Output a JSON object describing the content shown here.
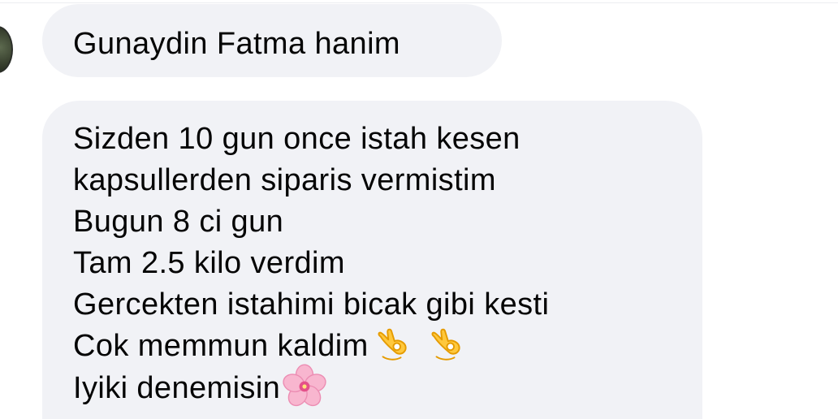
{
  "chat": {
    "messages": [
      {
        "lines": [
          "Gunaydin Fatma hanim"
        ]
      },
      {
        "lines": [
          "Sizden 10 gun once istah kesen",
          "kapsullerden siparis vermistim",
          "Bugun 8 ci gun",
          "Tam 2.5 kilo verdim",
          "Gercekten istahimi bicak gibi kesti",
          "Cok memmun kaldim",
          "Iyiki denemisin"
        ],
        "emojis": {
          "line_6": [
            "ok-hand-emoji",
            "ok-hand-emoji"
          ],
          "line_7": [
            "cherry-blossom-emoji"
          ]
        }
      }
    ]
  },
  "colors": {
    "bubble_background": "#f1f2f6",
    "text": "#050505",
    "ok_hand_fill": "#ffc83d",
    "ok_hand_shade": "#e59b00",
    "blossom_petal": "#f8b6cf",
    "blossom_center": "#e4508a"
  }
}
